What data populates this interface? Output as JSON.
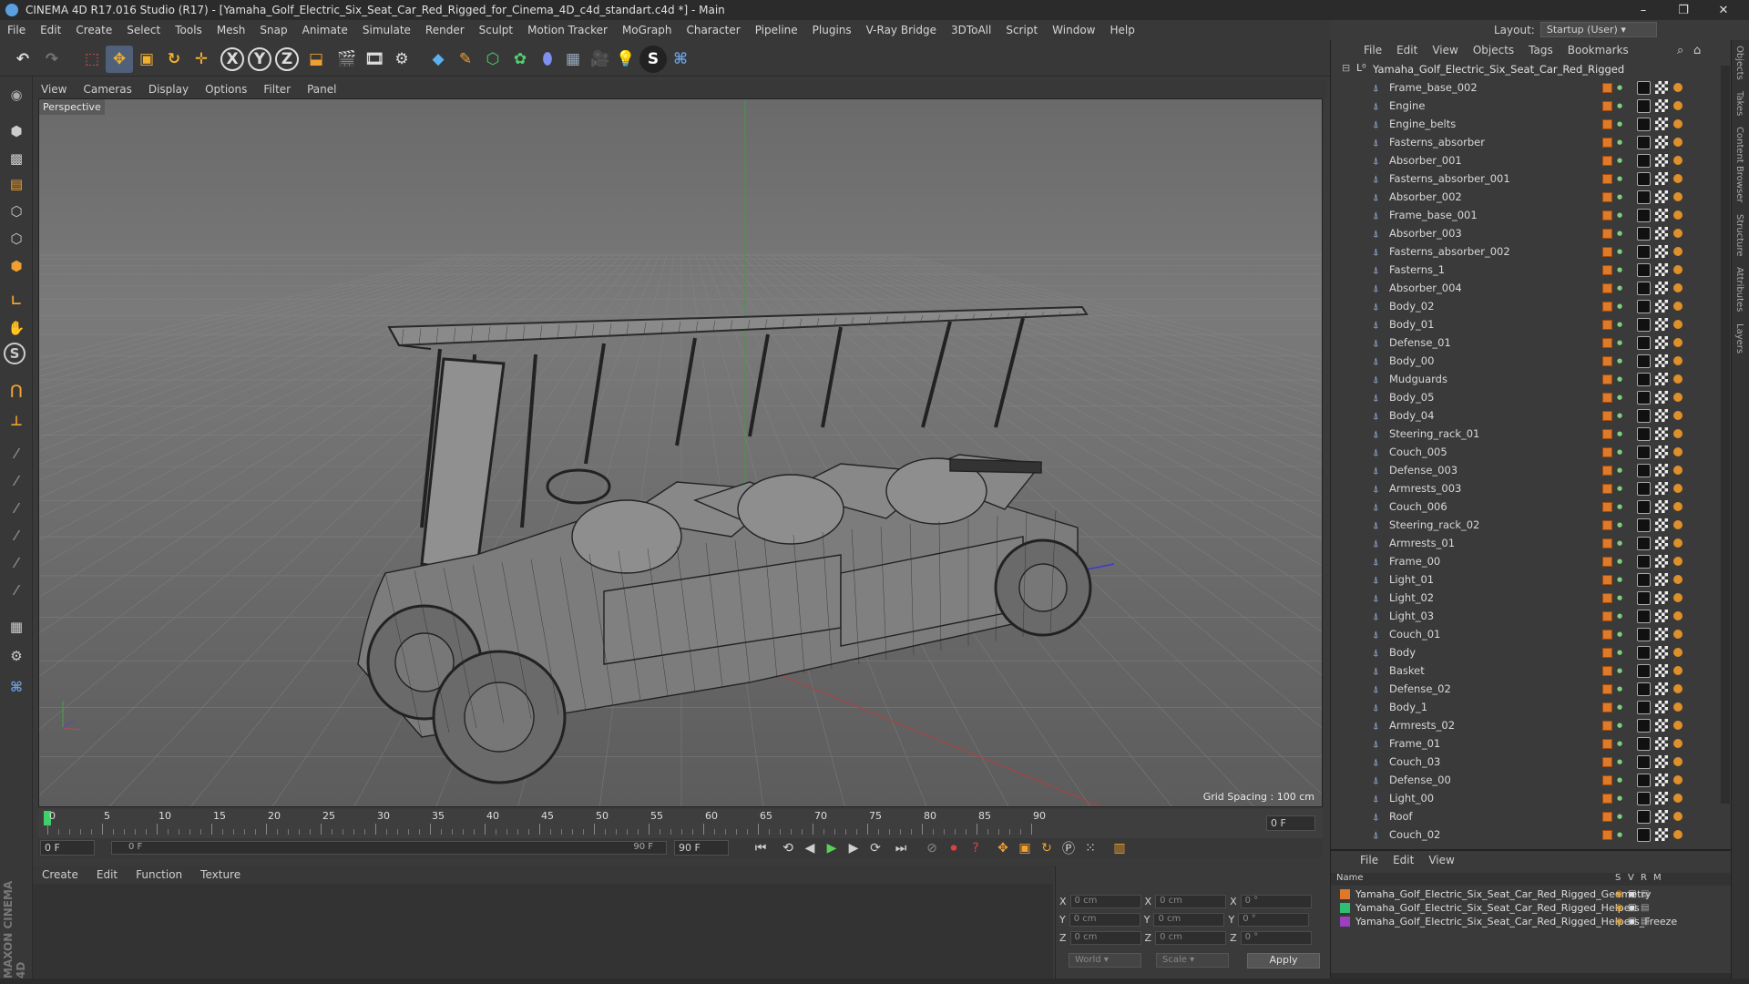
{
  "window": {
    "title": "CINEMA 4D R17.016 Studio (R17) - [Yamaha_Golf_Electric_Six_Seat_Car_Red_Rigged_for_Cinema_4D_c4d_standart.c4d *] - Main"
  },
  "menubar": [
    "File",
    "Edit",
    "Create",
    "Select",
    "Tools",
    "Mesh",
    "Snap",
    "Animate",
    "Simulate",
    "Render",
    "Sculpt",
    "Motion Tracker",
    "MoGraph",
    "Character",
    "Pipeline",
    "Plugins",
    "V-Ray Bridge",
    "3DToAll",
    "Script",
    "Window",
    "Help"
  ],
  "layout": {
    "label": "Layout:",
    "value": "Startup (User)"
  },
  "viewport": {
    "menu": [
      "View",
      "Cameras",
      "Display",
      "Options",
      "Filter",
      "Panel"
    ],
    "label": "Perspective",
    "grid_spacing": "Grid Spacing : 100 cm"
  },
  "timeline": {
    "ticks": [
      "0",
      "5",
      "10",
      "15",
      "20",
      "25",
      "30",
      "35",
      "40",
      "45",
      "50",
      "55",
      "60",
      "65",
      "70",
      "75",
      "80",
      "85",
      "90"
    ],
    "end_field": "0 F",
    "start_field": "0 F",
    "range_start": "0 F",
    "range_end": "90 F",
    "max_field": "90 F"
  },
  "material": {
    "menu": [
      "Create",
      "Edit",
      "Function",
      "Texture"
    ]
  },
  "coords": {
    "x": "X",
    "y": "Y",
    "z": "Z",
    "val_pos": "0 cm",
    "val_rot": "0 °",
    "world": "World",
    "scale": "Scale",
    "apply": "Apply"
  },
  "objects": {
    "menu": [
      "File",
      "Edit",
      "View",
      "Objects",
      "Tags",
      "Bookmarks"
    ],
    "root": "Yamaha_Golf_Electric_Six_Seat_Car_Red_Rigged",
    "items": [
      "Frame_base_002",
      "Engine",
      "Engine_belts",
      "Fasterns_absorber",
      "Absorber_001",
      "Fasterns_absorber_001",
      "Absorber_002",
      "Frame_base_001",
      "Absorber_003",
      "Fasterns_absorber_002",
      "Fasterns_1",
      "Absorber_004",
      "Body_02",
      "Body_01",
      "Defense_01",
      "Body_00",
      "Mudguards",
      "Body_05",
      "Body_04",
      "Steering_rack_01",
      "Couch_005",
      "Defense_003",
      "Armrests_003",
      "Couch_006",
      "Steering_rack_02",
      "Armrests_01",
      "Frame_00",
      "Light_01",
      "Light_02",
      "Light_03",
      "Couch_01",
      "Body",
      "Basket",
      "Defense_02",
      "Body_1",
      "Armrests_02",
      "Frame_01",
      "Couch_03",
      "Defense_00",
      "Light_00",
      "Roof",
      "Couch_02"
    ]
  },
  "layers": {
    "menu": [
      "File",
      "Edit",
      "View"
    ],
    "header": {
      "name": "Name",
      "s": "S",
      "v": "V",
      "r": "R",
      "m": "M"
    },
    "items": [
      {
        "name": "Yamaha_Golf_Electric_Six_Seat_Car_Red_Rigged_Geometry",
        "color": "#e0782a"
      },
      {
        "name": "Yamaha_Golf_Electric_Six_Seat_Car_Red_Rigged_Helpers",
        "color": "#2ec070"
      },
      {
        "name": "Yamaha_Golf_Electric_Six_Seat_Car_Red_Rigged_Helpers_Freeze",
        "color": "#9a40c0"
      }
    ]
  },
  "right_tabs": [
    "Objects",
    "Takes",
    "Content Browser",
    "Structure",
    "Attributes",
    "Layers"
  ],
  "maxon": {
    "line1": "MAXON",
    "line2": "CINEMA 4D"
  }
}
